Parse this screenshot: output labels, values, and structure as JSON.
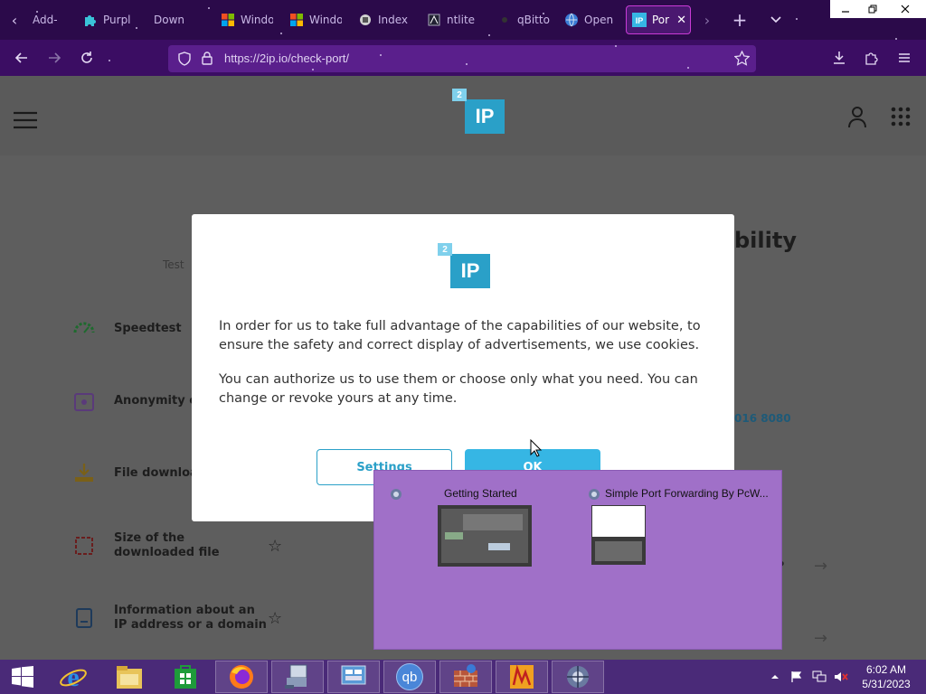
{
  "browser": {
    "tabs": [
      {
        "label": "Add-",
        "icon": "addon-icon"
      },
      {
        "label": "Purpl",
        "icon": "puzzle-icon"
      },
      {
        "label": "Down",
        "icon": "download-page-icon"
      },
      {
        "label": "Windo",
        "icon": "windows-logo-icon"
      },
      {
        "label": "Windo",
        "icon": "windows-logo-icon"
      },
      {
        "label": "Index",
        "icon": "index-icon"
      },
      {
        "label": "ntlite",
        "icon": "ntlite-icon"
      },
      {
        "label": "qBitto",
        "icon": "qbittorrent-icon"
      },
      {
        "label": "Open",
        "icon": "globe-icon"
      },
      {
        "label": "Por",
        "icon": "2ip-icon"
      }
    ],
    "new_tab_label": "+",
    "url": "https://2ip.io/check-port/",
    "accent": "#3b0d63"
  },
  "page": {
    "logo_main": "IP",
    "logo_small": "2",
    "heading_partial": "bility",
    "faint_label": "Test",
    "port_partial": "016 8080",
    "question_partial": "?",
    "sidebar": [
      {
        "label": "Speedtest",
        "icon": "speedometer-icon"
      },
      {
        "label": "Anonymity c",
        "icon": "lock-icon"
      },
      {
        "label": "File downloa",
        "icon": "download-icon"
      },
      {
        "label": "Size of the downloaded file",
        "icon": "file-size-icon"
      },
      {
        "label": "Information about an IP address or a domain",
        "icon": "ip-info-icon"
      }
    ]
  },
  "modal": {
    "logo_main": "IP",
    "logo_small": "2",
    "paragraph1": "In order for us to take full advantage of the capabilities of our website, to ensure the safety and correct display of advertisements, we use cookies.",
    "paragraph2": "You can authorize us to use them or choose only what you need. You can change or revoke yours at any time.",
    "settings_label": "Settings",
    "ok_label": "OK"
  },
  "thumbnails": [
    {
      "title": "Getting Started",
      "icon": "port-forward-app-icon"
    },
    {
      "title": "Simple Port Forwarding By PcW...",
      "icon": "port-forward-app-icon"
    }
  ],
  "taskbar": {
    "apps": [
      "start-icon",
      "internet-explorer-icon",
      "file-explorer-icon",
      "store-icon",
      "firefox-icon",
      "network-tool-icon",
      "remote-desktop-icon",
      "qbittorrent-icon",
      "firewall-icon",
      "app-icon",
      "port-forward-app-icon"
    ],
    "qb_label": "qb",
    "time": "6:02 AM",
    "date": "5/31/2023"
  }
}
